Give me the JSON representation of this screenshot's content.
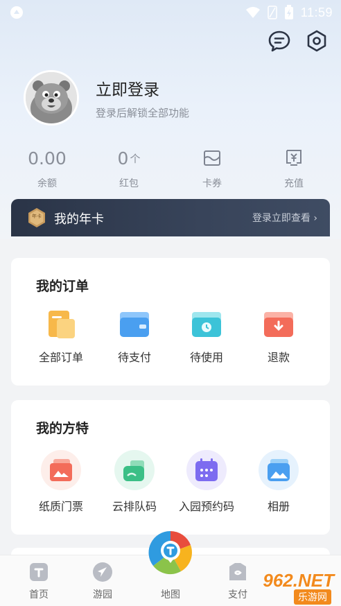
{
  "status_bar": {
    "time": "11:59"
  },
  "header": {
    "message_icon": "chat-icon",
    "settings_icon": "hexagon-settings-icon"
  },
  "profile": {
    "login_title": "立即登录",
    "login_subtitle": "登录后解锁全部功能"
  },
  "stats": [
    {
      "value": "0.00",
      "unit": "",
      "label": "余额"
    },
    {
      "value": "0",
      "unit": "个",
      "label": "红包"
    },
    {
      "icon": "coupon-icon",
      "label": "卡券"
    },
    {
      "icon": "recharge-icon",
      "label": "充值"
    }
  ],
  "annual_card": {
    "badge": "年卡",
    "title": "我的年卡",
    "link": "登录立即查看 ›"
  },
  "orders": {
    "title": "我的订单",
    "items": [
      {
        "label": "全部订单",
        "icon": "all-orders-icon"
      },
      {
        "label": "待支付",
        "icon": "wallet-icon"
      },
      {
        "label": "待使用",
        "icon": "clock-card-icon"
      },
      {
        "label": "退款",
        "icon": "refund-icon"
      }
    ]
  },
  "fangte": {
    "title": "我的方特",
    "items": [
      {
        "label": "纸质门票",
        "icon": "paper-ticket-icon"
      },
      {
        "label": "云排队码",
        "icon": "cloud-queue-icon"
      },
      {
        "label": "入园预约码",
        "icon": "calendar-icon"
      },
      {
        "label": "相册",
        "icon": "photo-album-icon"
      }
    ]
  },
  "tabbar": {
    "items": [
      {
        "label": "首页",
        "icon": "home-icon"
      },
      {
        "label": "游园",
        "icon": "navigation-icon"
      },
      {
        "label": "地图",
        "icon": "map-pin-icon"
      },
      {
        "label": "支付",
        "icon": "pay-icon"
      }
    ]
  },
  "watermark": {
    "text": "962.NET",
    "sub": "乐游网"
  },
  "colors": {
    "accent_dark": "#2a3447",
    "orange": "#f7b84a",
    "blue": "#4a9ff0",
    "cyan": "#3cc3d8",
    "red": "#f36c5a",
    "purple": "#7d6cf0"
  }
}
